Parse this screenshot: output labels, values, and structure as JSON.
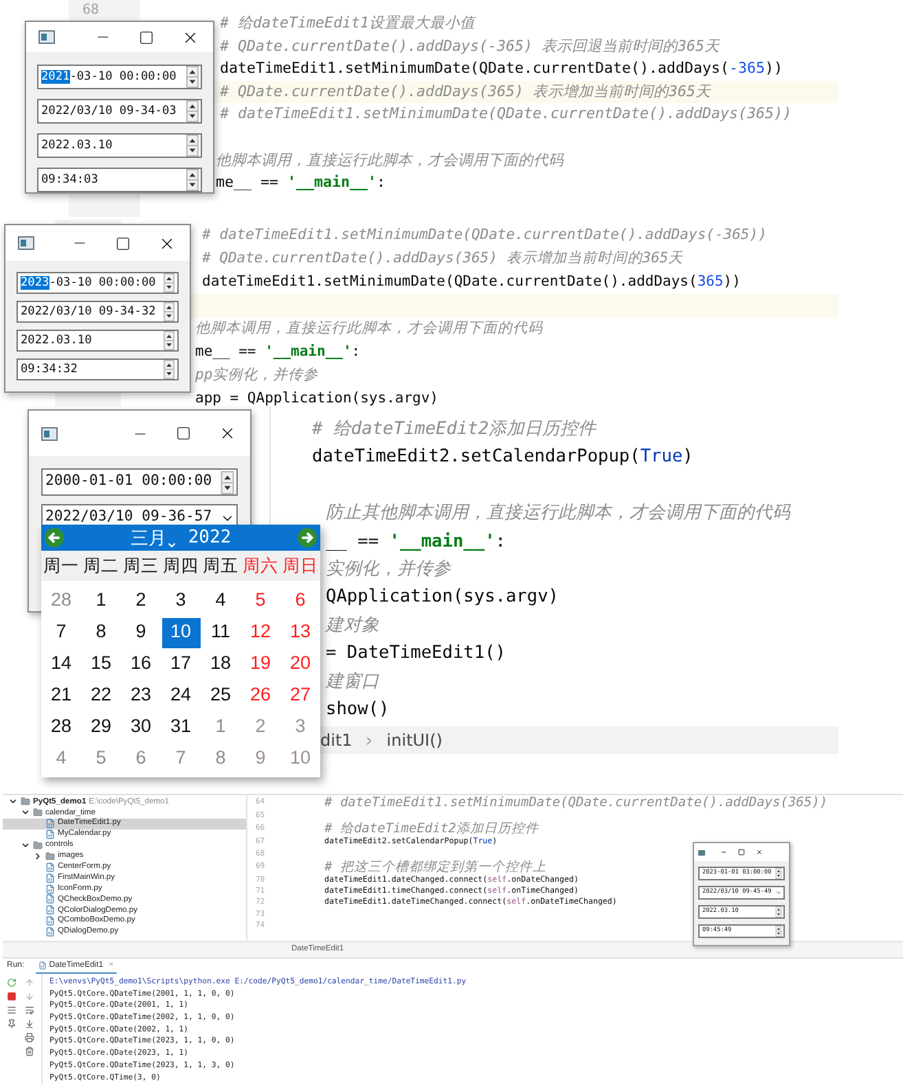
{
  "snippets": [
    {
      "line_number": "68",
      "lines": [
        {
          "kind": "code",
          "indented": true,
          "highlighted": false,
          "parts": [
            {
              "kind": "comment",
              "text": "# 给dateTimeEdit1设置最大最小值"
            }
          ]
        },
        {
          "kind": "code",
          "indented": true,
          "highlighted": false,
          "parts": [
            {
              "kind": "comment",
              "text": "# QDate.currentDate().addDays(-365) 表示回退当前时间的365天"
            }
          ]
        },
        {
          "kind": "code",
          "indented": true,
          "highlighted": false,
          "parts": [
            {
              "kind": "plain",
              "text": "dateTimeEdit1.setMinimumDate(QDate.currentDate().addDays("
            },
            {
              "kind": "number",
              "text": "-365"
            },
            {
              "kind": "plain",
              "text": "))"
            }
          ]
        },
        {
          "kind": "code",
          "indented": true,
          "highlighted": true,
          "parts": [
            {
              "kind": "comment",
              "text": "# QDate.currentDate().addDays(365)    表示增加当前时间的365天"
            }
          ]
        },
        {
          "kind": "code",
          "indented": true,
          "highlighted": false,
          "parts": [
            {
              "kind": "comment",
              "text": "# dateTimeEdit1.setMinimumDate(QDate.currentDate().addDays(365))"
            }
          ]
        },
        {
          "kind": "blank",
          "highlighted": false
        },
        {
          "kind": "code",
          "indented": false,
          "highlighted": false,
          "parts": [
            {
              "kind": "comment",
              "text": "他脚本调用，直接运行此脚本，才会调用下面的代码"
            }
          ]
        },
        {
          "kind": "code",
          "indented": false,
          "highlighted": false,
          "parts": [
            {
              "kind": "plain",
              "text": "me__ == "
            },
            {
              "kind": "string",
              "text": "'__main__'"
            },
            {
              "kind": "plain",
              "text": ":"
            }
          ]
        }
      ]
    },
    {
      "lines": [
        {
          "kind": "code",
          "indented": true,
          "highlighted": false,
          "parts": [
            {
              "kind": "comment",
              "text": "# dateTimeEdit1.setMinimumDate(QDate.currentDate().addDays(-365))"
            }
          ]
        },
        {
          "kind": "code",
          "indented": true,
          "highlighted": false,
          "parts": [
            {
              "kind": "comment",
              "text": "# QDate.currentDate().addDays(365)    表示增加当前时间的365天"
            }
          ]
        },
        {
          "kind": "code",
          "indented": true,
          "highlighted": false,
          "parts": [
            {
              "kind": "plain",
              "text": "dateTimeEdit1.setMinimumDate(QDate.currentDate().addDays("
            },
            {
              "kind": "number",
              "text": "365"
            },
            {
              "kind": "plain",
              "text": "))"
            }
          ]
        },
        {
          "kind": "blank",
          "highlighted": true
        },
        {
          "kind": "code",
          "indented": false,
          "highlighted": false,
          "parts": [
            {
              "kind": "comment",
              "text": "他脚本调用，直接运行此脚本，才会调用下面的代码"
            }
          ]
        },
        {
          "kind": "code",
          "indented": false,
          "highlighted": false,
          "parts": [
            {
              "kind": "plain",
              "text": "me__ == "
            },
            {
              "kind": "string",
              "text": "'__main__'"
            },
            {
              "kind": "plain",
              "text": ":"
            }
          ]
        },
        {
          "kind": "code",
          "indented": false,
          "highlighted": false,
          "parts": [
            {
              "kind": "comment",
              "text": "pp实例化，并传参"
            }
          ]
        },
        {
          "kind": "code",
          "indented": false,
          "highlighted": false,
          "parts": [
            {
              "kind": "plain",
              "text": "app = QApplication(sys.argv)"
            }
          ]
        }
      ]
    },
    {
      "lines": [
        {
          "kind": "code",
          "indented": true,
          "highlighted": false,
          "parts": [
            {
              "kind": "comment",
              "text": "# 给dateTimeEdit2添加日历控件"
            }
          ]
        },
        {
          "kind": "code",
          "indented": true,
          "highlighted": false,
          "parts": [
            {
              "kind": "plain",
              "text": "dateTimeEdit2.setCalendarPopup("
            },
            {
              "kind": "keyword",
              "text": "True"
            },
            {
              "kind": "plain",
              "text": ")"
            }
          ]
        },
        {
          "kind": "blank",
          "highlighted": false
        },
        {
          "kind": "code",
          "indented": false,
          "highlighted": false,
          "parts": [
            {
              "kind": "comment",
              "text": "防止其他脚本调用，直接运行此脚本，才会调用下面的代码"
            }
          ]
        },
        {
          "kind": "code",
          "indented": false,
          "highlighted": false,
          "parts": [
            {
              "kind": "plain",
              "text": "__ == "
            },
            {
              "kind": "string",
              "text": "'__main__'"
            },
            {
              "kind": "plain",
              "text": ":"
            }
          ]
        },
        {
          "kind": "code",
          "indented": false,
          "highlighted": false,
          "parts": [
            {
              "kind": "comment",
              "text": "实例化，并传参"
            }
          ]
        },
        {
          "kind": "code",
          "indented": false,
          "highlighted": false,
          "parts": [
            {
              "kind": "plain",
              "text": "QApplication(sys.argv)"
            }
          ]
        },
        {
          "kind": "code",
          "indented": false,
          "highlighted": false,
          "parts": [
            {
              "kind": "comment",
              "text": "建对象"
            }
          ]
        },
        {
          "kind": "code",
          "indented": false,
          "highlighted": false,
          "parts": [
            {
              "kind": "plain",
              "text": "= DateTimeEdit1()"
            }
          ]
        },
        {
          "kind": "code",
          "indented": false,
          "highlighted": false,
          "parts": [
            {
              "kind": "comment",
              "text": "建窗口"
            }
          ]
        },
        {
          "kind": "code",
          "indented": false,
          "highlighted": false,
          "parts": [
            {
              "kind": "plain",
              "text": "show()"
            }
          ]
        }
      ],
      "breadcrumb": [
        "dit1",
        "initUI()"
      ]
    }
  ],
  "windows": [
    {
      "fields": [
        {
          "kind": "spinbox",
          "selection": "2021",
          "value": "-03-10 00:00:00"
        },
        {
          "kind": "spinbox",
          "value": "2022/03/10 09-34-03"
        },
        {
          "kind": "spinbox",
          "value": "2022.03.10"
        },
        {
          "kind": "spinbox",
          "value": "09:34:03"
        }
      ]
    },
    {
      "fields": [
        {
          "kind": "spinbox",
          "selection": "2023",
          "value": "-03-10 00:00:00"
        },
        {
          "kind": "spinbox",
          "value": "2022/03/10 09-34-32"
        },
        {
          "kind": "spinbox",
          "value": "2022.03.10"
        },
        {
          "kind": "spinbox",
          "value": "09:34:32"
        }
      ]
    },
    {
      "fields": [
        {
          "kind": "spinbox",
          "value": "2000-01-01 00:00:00"
        },
        {
          "kind": "dropdown",
          "value": "2022/03/10 09-36-57"
        }
      ],
      "calendar": {
        "month": "三月",
        "year": "2022",
        "weekdays": [
          {
            "label": "周一",
            "weekend": false
          },
          {
            "label": "周二",
            "weekend": false
          },
          {
            "label": "周三",
            "weekend": false
          },
          {
            "label": "周四",
            "weekend": false
          },
          {
            "label": "周五",
            "weekend": false
          },
          {
            "label": "周六",
            "weekend": true
          },
          {
            "label": "周日",
            "weekend": true
          }
        ],
        "days": [
          {
            "label": "28",
            "in_month": false,
            "weekend": false,
            "selected": false
          },
          {
            "label": "1",
            "in_month": true,
            "weekend": false,
            "selected": false
          },
          {
            "label": "2",
            "in_month": true,
            "weekend": false,
            "selected": false
          },
          {
            "label": "3",
            "in_month": true,
            "weekend": false,
            "selected": false
          },
          {
            "label": "4",
            "in_month": true,
            "weekend": false,
            "selected": false
          },
          {
            "label": "5",
            "in_month": true,
            "weekend": true,
            "selected": false
          },
          {
            "label": "6",
            "in_month": true,
            "weekend": true,
            "selected": false
          },
          {
            "label": "7",
            "in_month": true,
            "weekend": false,
            "selected": false
          },
          {
            "label": "8",
            "in_month": true,
            "weekend": false,
            "selected": false
          },
          {
            "label": "9",
            "in_month": true,
            "weekend": false,
            "selected": false
          },
          {
            "label": "10",
            "in_month": true,
            "weekend": false,
            "selected": true
          },
          {
            "label": "11",
            "in_month": true,
            "weekend": false,
            "selected": false
          },
          {
            "label": "12",
            "in_month": true,
            "weekend": true,
            "selected": false
          },
          {
            "label": "13",
            "in_month": true,
            "weekend": true,
            "selected": false
          },
          {
            "label": "14",
            "in_month": true,
            "weekend": false,
            "selected": false
          },
          {
            "label": "15",
            "in_month": true,
            "weekend": false,
            "selected": false
          },
          {
            "label": "16",
            "in_month": true,
            "weekend": false,
            "selected": false
          },
          {
            "label": "17",
            "in_month": true,
            "weekend": false,
            "selected": false
          },
          {
            "label": "18",
            "in_month": true,
            "weekend": false,
            "selected": false
          },
          {
            "label": "19",
            "in_month": true,
            "weekend": true,
            "selected": false
          },
          {
            "label": "20",
            "in_month": true,
            "weekend": true,
            "selected": false
          },
          {
            "label": "21",
            "in_month": true,
            "weekend": false,
            "selected": false
          },
          {
            "label": "22",
            "in_month": true,
            "weekend": false,
            "selected": false
          },
          {
            "label": "23",
            "in_month": true,
            "weekend": false,
            "selected": false
          },
          {
            "label": "24",
            "in_month": true,
            "weekend": false,
            "selected": false
          },
          {
            "label": "25",
            "in_month": true,
            "weekend": false,
            "selected": false
          },
          {
            "label": "26",
            "in_month": true,
            "weekend": true,
            "selected": false
          },
          {
            "label": "27",
            "in_month": true,
            "weekend": true,
            "selected": false
          },
          {
            "label": "28",
            "in_month": true,
            "weekend": false,
            "selected": false
          },
          {
            "label": "29",
            "in_month": true,
            "weekend": false,
            "selected": false
          },
          {
            "label": "30",
            "in_month": true,
            "weekend": false,
            "selected": false
          },
          {
            "label": "31",
            "in_month": true,
            "weekend": false,
            "selected": false
          },
          {
            "label": "1",
            "in_month": false,
            "weekend": false,
            "selected": false
          },
          {
            "label": "2",
            "in_month": false,
            "weekend": true,
            "selected": false
          },
          {
            "label": "3",
            "in_month": false,
            "weekend": true,
            "selected": false
          },
          {
            "label": "4",
            "in_month": false,
            "weekend": false,
            "selected": false
          },
          {
            "label": "5",
            "in_month": false,
            "weekend": false,
            "selected": false
          },
          {
            "label": "6",
            "in_month": false,
            "weekend": false,
            "selected": false
          },
          {
            "label": "7",
            "in_month": false,
            "weekend": false,
            "selected": false
          },
          {
            "label": "8",
            "in_month": false,
            "weekend": false,
            "selected": false
          },
          {
            "label": "9",
            "in_month": false,
            "weekend": true,
            "selected": false
          },
          {
            "label": "10",
            "in_month": false,
            "weekend": true,
            "selected": false
          }
        ]
      }
    }
  ],
  "ide": {
    "tree": [
      {
        "kind": "folder",
        "label": "PyQt5_demo1",
        "hint": "E:\\code\\PyQt5_demo1",
        "expanded": true,
        "selected": false,
        "children": [
          {
            "kind": "folder",
            "label": "calendar_time",
            "expanded": true,
            "selected": false,
            "children": [
              {
                "kind": "file",
                "label": "DateTimeEdit1.py",
                "selected": true
              },
              {
                "kind": "file",
                "label": "MyCalendar.py",
                "selected": false
              }
            ]
          },
          {
            "kind": "folder",
            "label": "controls",
            "expanded": true,
            "selected": false,
            "children": [
              {
                "kind": "folder",
                "label": "images",
                "expanded": false,
                "selected": false
              },
              {
                "kind": "file",
                "label": "CenterForm.py",
                "selected": false
              },
              {
                "kind": "file",
                "label": "FirstMainWin.py",
                "selected": false
              },
              {
                "kind": "file",
                "label": "IconForm.py",
                "selected": false
              },
              {
                "kind": "file",
                "label": "QCheckBoxDemo.py",
                "selected": false
              },
              {
                "kind": "file",
                "label": "QColorDialogDemo.py",
                "selected": false
              },
              {
                "kind": "file",
                "label": "QComboBoxDemo.py",
                "selected": false
              },
              {
                "kind": "file",
                "label": "QDialogDemo.py",
                "selected": false
              }
            ]
          }
        ]
      }
    ],
    "editor": [
      {
        "number": "64",
        "kind": "code",
        "parts": [
          {
            "kind": "comment",
            "text": "# dateTimeEdit1.setMinimumDate(QDate.currentDate().addDays(365))"
          }
        ]
      },
      {
        "number": "65",
        "kind": "blank"
      },
      {
        "number": "66",
        "kind": "code",
        "parts": [
          {
            "kind": "comment",
            "text": "# 给dateTimeEdit2添加日历控件"
          }
        ]
      },
      {
        "number": "67",
        "kind": "code",
        "parts": [
          {
            "kind": "plain",
            "text": "dateTimeEdit2.setCalendarPopup("
          },
          {
            "kind": "keyword",
            "text": "True"
          },
          {
            "kind": "plain",
            "text": ")"
          }
        ]
      },
      {
        "number": "68",
        "kind": "blank"
      },
      {
        "number": "69",
        "kind": "code",
        "parts": [
          {
            "kind": "comment",
            "text": "# 把这三个槽都绑定到第一个控件上"
          }
        ]
      },
      {
        "number": "70",
        "kind": "code",
        "parts": [
          {
            "kind": "plain",
            "text": "dateTimeEdit1.dateChanged.connect("
          },
          {
            "kind": "self",
            "text": "self"
          },
          {
            "kind": "plain",
            "text": ".onDateChanged)"
          }
        ]
      },
      {
        "number": "71",
        "kind": "code",
        "parts": [
          {
            "kind": "plain",
            "text": "dateTimeEdit1.timeChanged.connect("
          },
          {
            "kind": "self",
            "text": "self"
          },
          {
            "kind": "plain",
            "text": ".onTimeChanged)"
          }
        ]
      },
      {
        "number": "72",
        "kind": "code",
        "parts": [
          {
            "kind": "plain",
            "text": "dateTimeEdit1.dateTimeChanged.connect("
          },
          {
            "kind": "self",
            "text": "self"
          },
          {
            "kind": "plain",
            "text": ".onDateTimeChanged)"
          }
        ]
      },
      {
        "number": "73",
        "kind": "blank"
      },
      {
        "number": "74",
        "kind": "blank"
      }
    ],
    "breadcrumb": "DateTimeEdit1",
    "preview_fields": [
      {
        "kind": "spinbox",
        "value": "2023-01-01 03:00:00"
      },
      {
        "kind": "dropdown",
        "value": "2022/03/10 09-45-49"
      },
      {
        "kind": "spinbox",
        "value": "2022.03.10"
      },
      {
        "kind": "spinbox",
        "value": "09:45:49"
      }
    ],
    "run": {
      "label": "Run:",
      "tab": "DateTimeEdit1",
      "close": "×",
      "output": [
        {
          "kind": "command",
          "text": "E:\\venvs\\PyQt5_demo1\\Scripts\\python.exe E:/code/PyQt5_demo1/calendar_time/DateTimeEdit1.py"
        },
        {
          "kind": "output",
          "text": "PyQt5.QtCore.QDateTime(2001, 1, 1, 0, 0)"
        },
        {
          "kind": "output",
          "text": "PyQt5.QtCore.QDate(2001, 1, 1)"
        },
        {
          "kind": "output",
          "text": "PyQt5.QtCore.QDateTime(2002, 1, 1, 0, 0)"
        },
        {
          "kind": "output",
          "text": "PyQt5.QtCore.QDate(2002, 1, 1)"
        },
        {
          "kind": "output",
          "text": "PyQt5.QtCore.QDateTime(2023, 1, 1, 0, 0)"
        },
        {
          "kind": "output",
          "text": "PyQt5.QtCore.QDate(2023, 1, 1)"
        },
        {
          "kind": "output",
          "text": "PyQt5.QtCore.QDateTime(2023, 1, 1, 3, 0)"
        },
        {
          "kind": "output",
          "text": "PyQt5.QtCore.QTime(3, 0)"
        }
      ]
    }
  }
}
